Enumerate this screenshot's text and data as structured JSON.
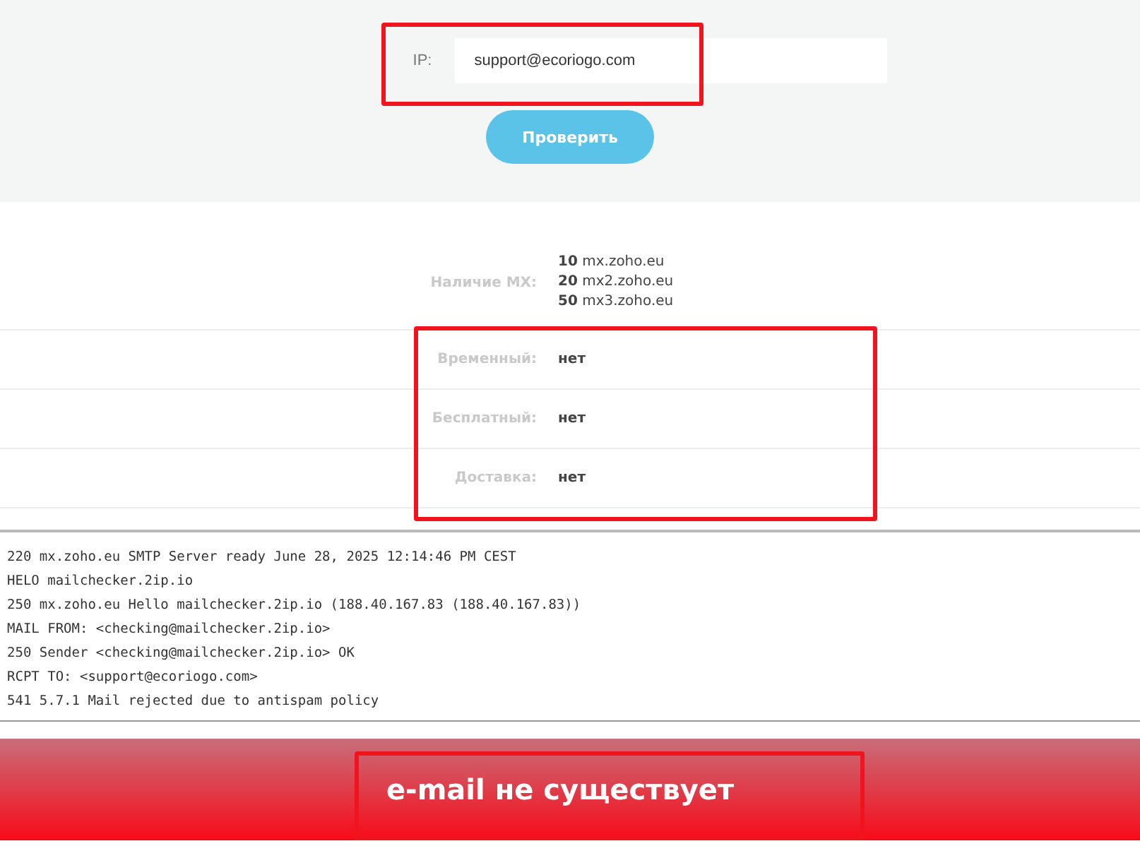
{
  "form": {
    "label": "IP:",
    "value": "support@ecoriogo.com",
    "button": "Проверить"
  },
  "mx": {
    "label": "Наличие MX:",
    "records": [
      {
        "priority": "10",
        "host": "mx.zoho.eu"
      },
      {
        "priority": "20",
        "host": "mx2.zoho.eu"
      },
      {
        "priority": "50",
        "host": "mx3.zoho.eu"
      }
    ]
  },
  "checks": [
    {
      "label": "Временный:",
      "value": "нет"
    },
    {
      "label": "Бесплатный:",
      "value": "нет"
    },
    {
      "label": "Доставка:",
      "value": "нет"
    }
  ],
  "log": [
    "220 mx.zoho.eu SMTP Server ready June 28, 2025 12:14:46 PM CEST",
    "HELO mailchecker.2ip.io",
    "250 mx.zoho.eu Hello mailchecker.2ip.io (188.40.167.83 (188.40.167.83))",
    "MAIL FROM: <checking@mailchecker.2ip.io>",
    "250 Sender <checking@mailchecker.2ip.io> OK",
    "RCPT TO: <support@ecoriogo.com>",
    "541 5.7.1 Mail rejected due to antispam policy"
  ],
  "result": "e-mail не существует"
}
